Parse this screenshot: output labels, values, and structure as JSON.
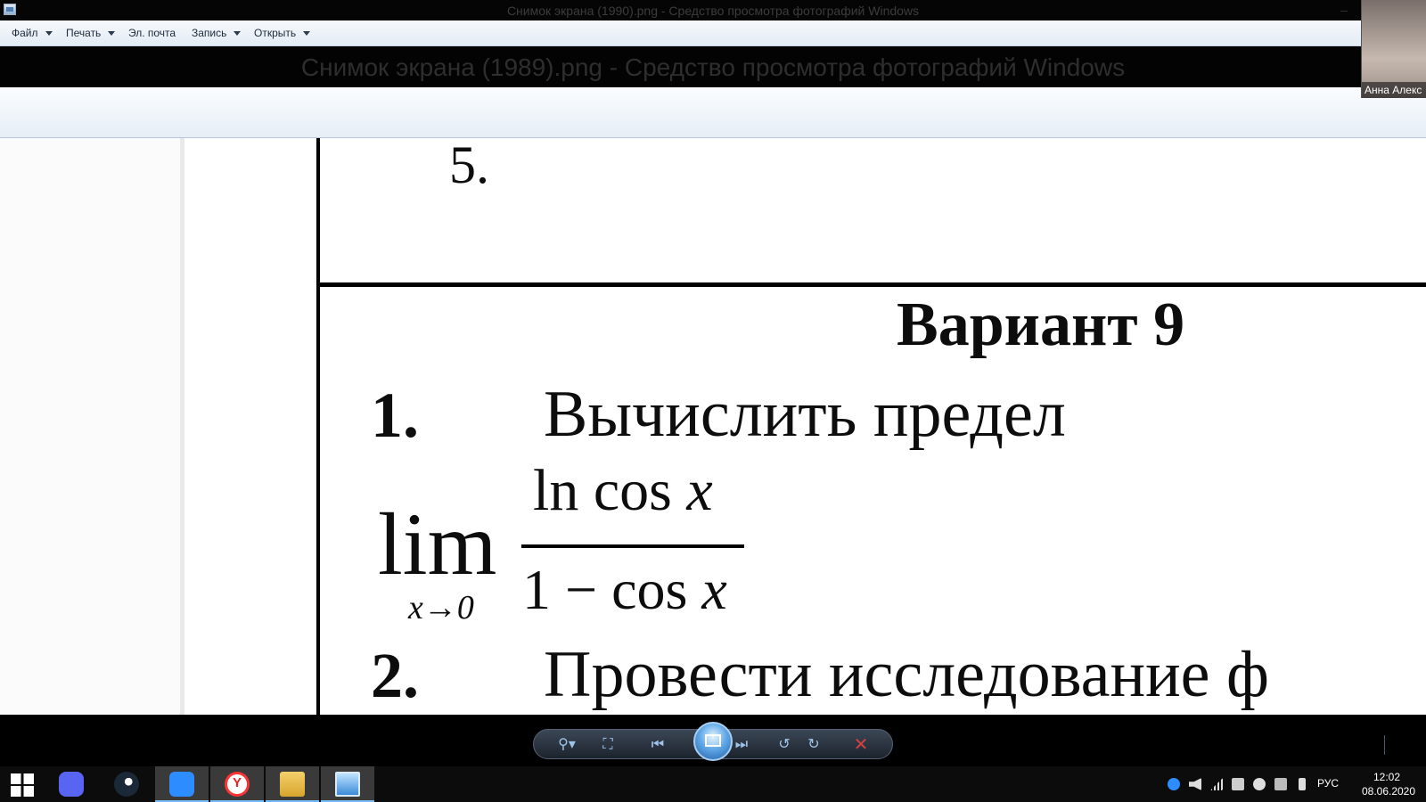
{
  "window": {
    "outer_title": "Снимок экрана (1990).png - Средство просмотра фотографий Windows",
    "inner_title": "Снимок экрана (1989).png - Средство просмотра фотографий Windows",
    "close_glyph": "–"
  },
  "menu": {
    "file": "Файл",
    "print": "Печать",
    "email": "Эл. почта",
    "burn": "Запись",
    "open": "Открыть"
  },
  "document": {
    "prev_item": "5.",
    "heading": "Вариант 9",
    "item1_number": "1.",
    "item1_text": "Вычислить предел",
    "lim_word": "lim",
    "lim_subscript": "x→0",
    "numerator_func": "ln cos ",
    "numerator_var": "x",
    "denominator_prefix": "1 − cos ",
    "denominator_var": "x",
    "item2_number": "2.",
    "item2_text": "Провести исследование ф"
  },
  "navigation": {
    "zoom_icon": "⚲▾",
    "fit_icon": "⛶",
    "prev_icon": "⏮",
    "next_icon": "⏭",
    "rotate_ccw_icon": "↺",
    "rotate_cw_icon": "↻",
    "delete_icon": "✕"
  },
  "taskbar": {
    "yandex_letter": "Y",
    "language": "РУС",
    "time": "12:02",
    "date": "08.06.2020"
  },
  "webcam": {
    "participant_name": "Анна Алекс"
  },
  "colors": {
    "accent": "#76b9ed",
    "delete": "#d64040",
    "zoom": "#2d8cff",
    "discord": "#5865f2"
  }
}
